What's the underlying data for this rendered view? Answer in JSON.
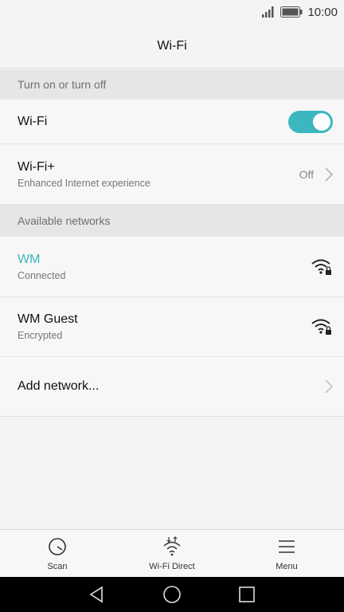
{
  "status_bar": {
    "time": "10:00"
  },
  "header": {
    "title": "Wi-Fi"
  },
  "sections": {
    "toggle_header": "Turn on or turn off",
    "available_header": "Available networks"
  },
  "wifi_toggle": {
    "label": "Wi-Fi",
    "state": "on"
  },
  "wifi_plus": {
    "label": "Wi-Fi+",
    "subtitle": "Enhanced Internet experience",
    "value": "Off"
  },
  "networks": [
    {
      "name": "WM",
      "status": "Connected",
      "icon": "wifi-locked-icon"
    },
    {
      "name": "WM Guest",
      "status": "Encrypted",
      "icon": "wifi-locked-icon"
    }
  ],
  "add_network": {
    "label": "Add network..."
  },
  "bottom_bar": {
    "scan": "Scan",
    "wifi_direct": "Wi-Fi Direct",
    "menu": "Menu"
  },
  "colors": {
    "accent": "#3cb6bf",
    "header_bg": "#e6e6e6"
  }
}
